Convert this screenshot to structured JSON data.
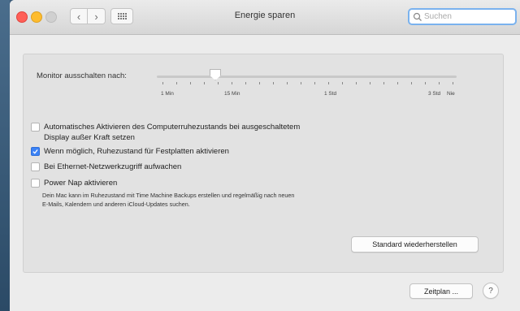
{
  "window": {
    "title": "Energie sparen"
  },
  "toolbar": {
    "back_glyph": "‹",
    "forward_glyph": "›",
    "grid_icon": "grid-icon",
    "search": {
      "placeholder": "Suchen",
      "value": ""
    }
  },
  "monitor_slider": {
    "label": "Monitor ausschalten nach:",
    "value_label": "15 Min",
    "value_fraction": 0.18,
    "tick_count": 22,
    "tick_labels": [
      "1 Min",
      "15 Min",
      "1 Std",
      "3 Std",
      "Nie"
    ]
  },
  "options": [
    {
      "label_line1": "Automatisches Aktivieren des Computerruhezustands bei ausgeschaltetem",
      "label_line2": "Display außer Kraft setzen",
      "checked": false
    },
    {
      "label_line1": "Wenn möglich, Ruhezustand für Festplatten aktivieren",
      "checked": true
    },
    {
      "label_line1": "Bei Ethernet-Netzwerkzugriff aufwachen",
      "checked": false
    },
    {
      "label_line1": "Power Nap aktivieren",
      "checked": false
    }
  ],
  "power_nap_description": {
    "line1": "Dein Mac kann im Ruhezustand mit Time Machine Backups erstellen und regelmäßig nach neuen",
    "line2": "E-Mails, Kalendern und anderen iCloud-Updates suchen."
  },
  "buttons": {
    "restore_defaults": "Standard wiederherstellen",
    "schedule": "Zeitplan ...",
    "help": "?"
  },
  "colors": {
    "accent": "#3b82f6",
    "close": "#ff5f57",
    "minimize": "#febc2e"
  }
}
